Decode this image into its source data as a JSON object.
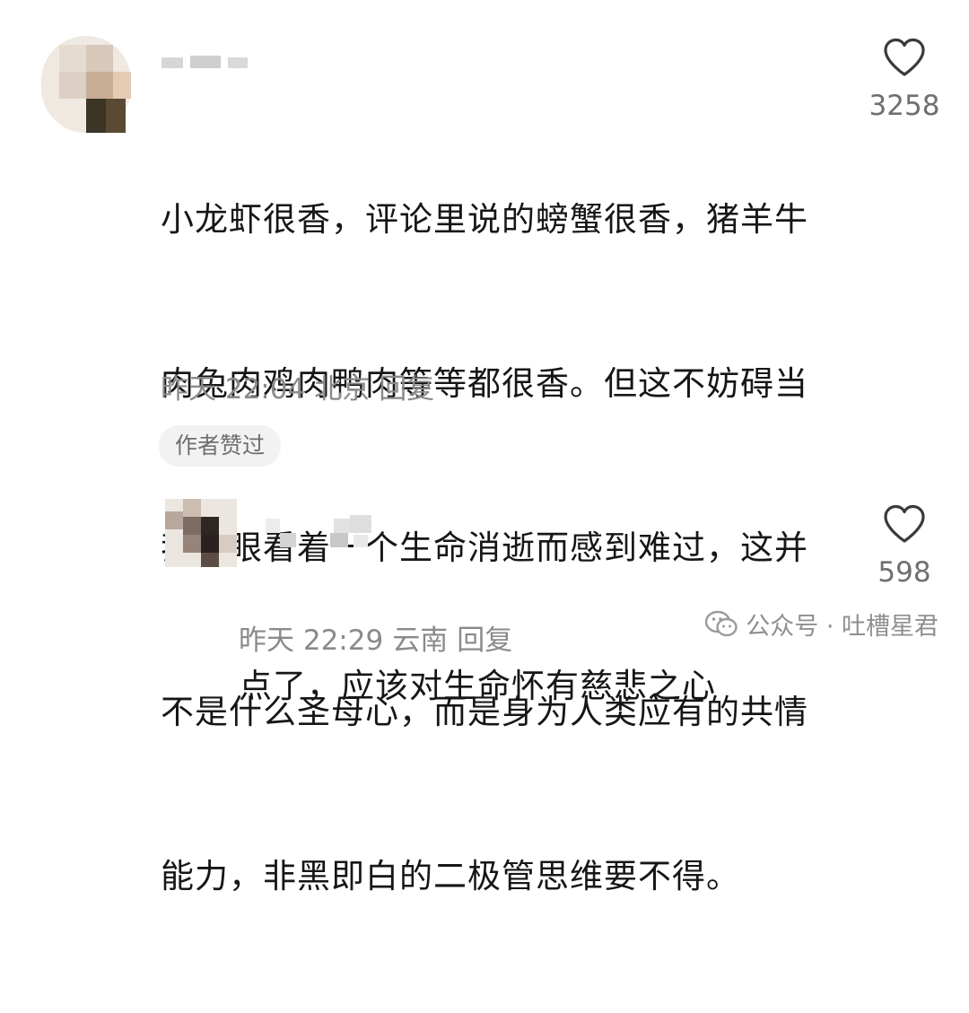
{
  "comments": [
    {
      "text_lines": [
        "小龙虾很香，评论里说的螃蟹很香，猪羊牛",
        "肉兔肉鸡肉鸭肉等等都很香。但这不妨碍当",
        "我们眼看着一个生命消逝而感到难过，这并",
        "不是什么圣母心，而是身为人类应有的共情",
        "能力，非黑即白的二极管思维要不得。"
      ],
      "date": "昨天 22:04",
      "location": "北京",
      "reply_label": "回复",
      "badge": "作者赞过",
      "likes": "3258"
    },
    {
      "text_lines": [
        "点了，应该对生命怀有慈悲之心"
      ],
      "date": "昨天 22:29",
      "location": "云南",
      "reply_label": "回复",
      "likes": "598"
    }
  ],
  "watermark": {
    "text": "公众号 · 吐槽星君",
    "icon": "wechat-icon"
  },
  "colors": {
    "text": "#161616",
    "meta": "#8a8a8a",
    "badge_bg": "#f2f2f2",
    "heart": "#3a3a3a"
  }
}
